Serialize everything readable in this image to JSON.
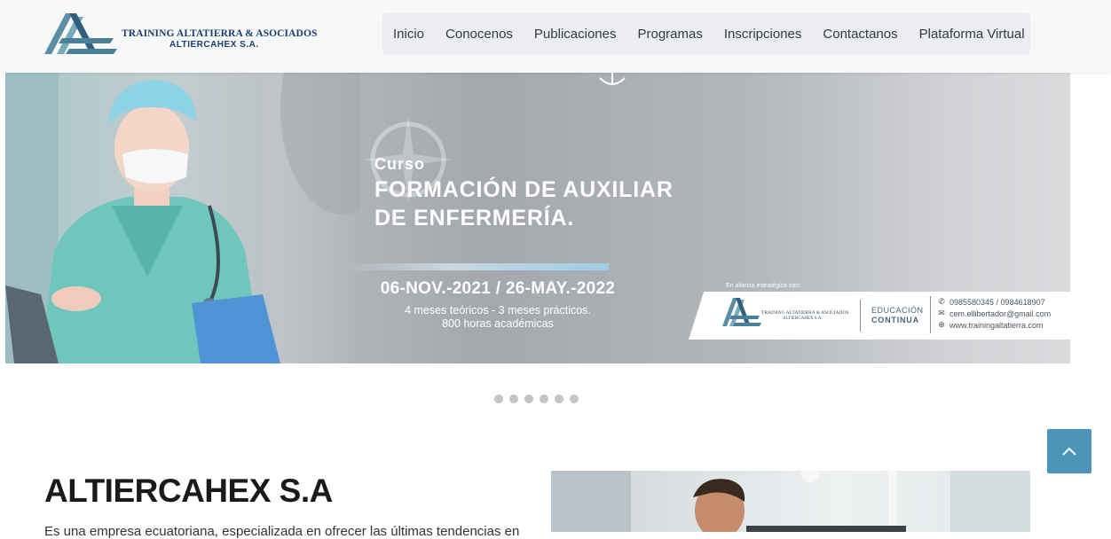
{
  "brand": {
    "name_line1": "TRAINING ALTATIERRA & ASOCIADOS",
    "name_line2": "ALTIERCAHEX S.A.",
    "colors": {
      "primary": "#1b3e6e",
      "accent": "#4a95b8",
      "mark": "#5a8fa6"
    }
  },
  "nav": {
    "items": [
      {
        "label": "Inicio"
      },
      {
        "label": "Conocenos"
      },
      {
        "label": "Publicaciones"
      },
      {
        "label": "Programas"
      },
      {
        "label": "Inscripciones"
      },
      {
        "label": "Contactanos"
      },
      {
        "label": "Plataforma Virtual"
      }
    ]
  },
  "banner": {
    "kicker": "Curso",
    "title_line1": "FORMACIÓN DE AUXILIAR",
    "title_line2": "DE ENFERMERÍA.",
    "dates": "06-NOV.-2021 / 26-MAY.-2022",
    "detail_line1": "4 meses teóricos - 3 meses prácticos.",
    "detail_line2": "800 horas académicas",
    "alliance_label": "En alianza estratégica con:",
    "alliance_logo_line1": "TRAINING ALTATIERRA & ASOCIADOS",
    "alliance_logo_line2": "ALTIERCAHEX S.A.",
    "education_line1": "EDUCACIÓN",
    "education_line2": "CONTINUA",
    "phone": "0985580345 / 0984618907",
    "email": "cem.ellibertador@gmail.com",
    "website": "www.trainingaltatierra.com",
    "icons": [
      "whatsapp-icon",
      "mail-icon",
      "globe-icon"
    ]
  },
  "carousel": {
    "slide_count": 6,
    "active_index": 0
  },
  "scroll_top": {
    "icon": "chevron-up-icon"
  },
  "about": {
    "title": "ALTIERCAHEX S.A",
    "text": "Es una empresa ecuatoriana, especializada en ofrecer las últimas tendencias en"
  }
}
